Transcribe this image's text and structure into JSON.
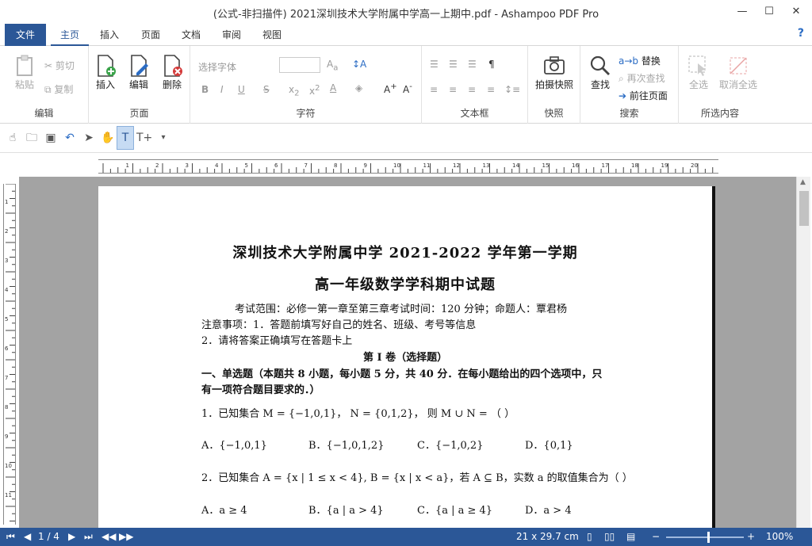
{
  "window": {
    "title": "(公式-非扫描件) 2021深圳技术大学附属中学高一上期中.pdf - Ashampoo PDF Pro",
    "minimize": "—",
    "maximize": "☐",
    "close": "✕"
  },
  "tabs": [
    "文件",
    "主页",
    "插入",
    "页面",
    "文档",
    "审阅",
    "视图"
  ],
  "help": "?",
  "ribbon": {
    "edit": {
      "label": "编辑",
      "paste": "粘贴",
      "cut": "剪切",
      "copy": "复制"
    },
    "page": {
      "label": "页面",
      "insert": "插入",
      "edit": "编辑",
      "delete": "删除"
    },
    "char": {
      "label": "字符",
      "font_placeholder": "选择字体"
    },
    "textbox": {
      "label": "文本框"
    },
    "snapshot": {
      "label": "快照",
      "button": "拍摄快照"
    },
    "search": {
      "label": "搜索",
      "find": "查找",
      "replace": "替换",
      "find_again": "再次查找",
      "goto": "前往页面"
    },
    "selection": {
      "label": "所选内容",
      "select_all": "全选",
      "deselect_all": "取消全选"
    }
  },
  "ruler": {
    "h_labels": [
      "1",
      "2",
      "3",
      "4",
      "5",
      "6",
      "7",
      "8",
      "9",
      "10",
      "11",
      "12",
      "13",
      "14",
      "15",
      "16",
      "17",
      "18",
      "19",
      "20"
    ],
    "v_labels": [
      "1",
      "2",
      "3",
      "4",
      "5",
      "6",
      "7",
      "8",
      "9",
      "10",
      "11",
      "12"
    ]
  },
  "document": {
    "title1": "深圳技术大学附属中学 2021-2022 学年第一学期",
    "title2": "高一年级数学学科期中试题",
    "scope": "考试范围：必修一第一章至第三章考试时间：120 分钟；命题人：覃君杨",
    "note1": "注意事项：1．答题前填写好自己的姓名、班级、考号等信息",
    "note2": "2．请将答案正确填写在答题卡上",
    "section": "第 I 卷（选择题）",
    "part1_line1": "一、单选题（本题共 8 小题，每小题 5 分，共 40 分．在每小题给出的四个选项中，只",
    "part1_line2": "有一项符合题目要求的．）",
    "q1": "1．已知集合 M = {−1,0,1}， N = {0,1,2}， 则 M ∪ N = （  ）",
    "q1_options": [
      "A．{−1,0,1}",
      "B．{−1,0,1,2}",
      "C．{−1,0,2}",
      "D．{0,1}"
    ],
    "q2": "2．已知集合 A = {x | 1 ≤ x < 4}, B = {x | x < a}，若 A ⊆ B，实数 a 的取值集合为（      ）",
    "q2_options": [
      "A．a ≥ 4",
      "B．{a | a > 4}",
      "C．{a | a ≥ 4}",
      "D．a > 4"
    ]
  },
  "status": {
    "page": "1 / 4",
    "size": "21 x 29.7 cm",
    "zoom": "100%",
    "zoom_level": 0.55
  }
}
